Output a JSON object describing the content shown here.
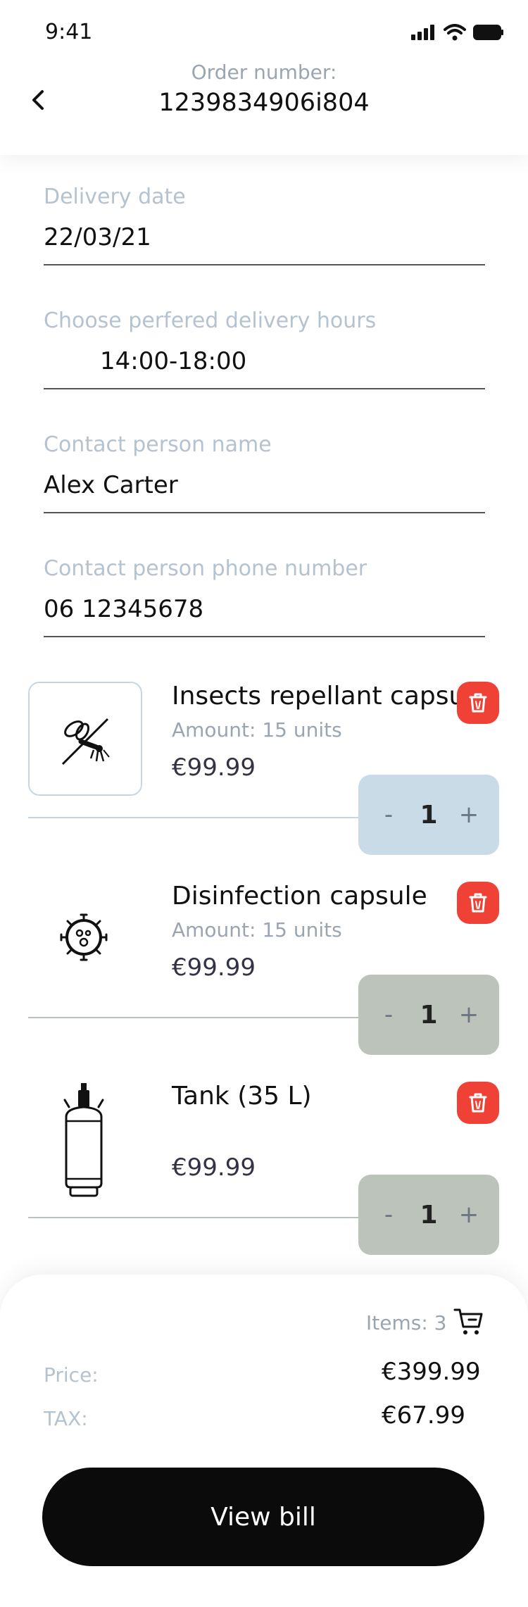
{
  "status": {
    "time": "9:41"
  },
  "header": {
    "order_label": "Order number:",
    "order_number": "1239834906i804"
  },
  "fields": {
    "delivery_date": {
      "label": "Delivery date",
      "value": "22/03/21"
    },
    "delivery_hours": {
      "label": "Choose perfered delivery hours",
      "value": "14:00-18:00"
    },
    "contact_name": {
      "label": "Contact person name",
      "value": "Alex Carter"
    },
    "contact_phone": {
      "label": "Contact person phone number",
      "value": "06 12345678"
    }
  },
  "products": [
    {
      "name": "Insects repellant capsule",
      "amount": "Amount: 15 units",
      "price": "€99.99",
      "qty": "1",
      "icon": "mosquito-icon"
    },
    {
      "name": "Disinfection capsule",
      "amount": "Amount: 15 units",
      "price": "€99.99",
      "qty": "1",
      "icon": "virus-icon"
    },
    {
      "name": "Tank (35 L)",
      "amount": "",
      "price": "€99.99",
      "qty": "1",
      "icon": "gas-tank-icon"
    }
  ],
  "stepper": {
    "minus": "-",
    "plus": "+"
  },
  "summary": {
    "items": "Items: 3",
    "price_label": "Price:",
    "price_value": "€399.99",
    "tax_label": "TAX:",
    "tax_value": "€67.99",
    "button": "View bill"
  },
  "colors": {
    "delete": "#ef4136",
    "stepper_active": "#c9dbe7",
    "stepper_inactive": "#bcc3ba",
    "button": "#0b0b0b"
  }
}
